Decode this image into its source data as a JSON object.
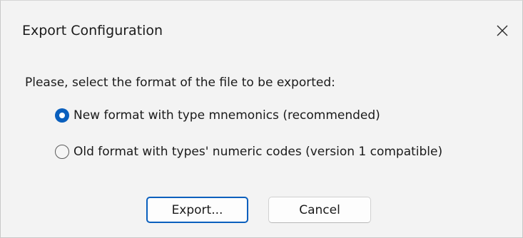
{
  "window": {
    "title": "Export Configuration",
    "close_icon": "close-icon"
  },
  "dialog": {
    "prompt": "Please, select the format of the file to be exported:",
    "options": [
      {
        "label": "New format with type mnemonics (recommended)",
        "selected": true
      },
      {
        "label": "Old format with types' numeric codes (version 1 compatible)",
        "selected": false
      }
    ],
    "buttons": {
      "export_label": "Export...",
      "cancel_label": "Cancel"
    }
  },
  "colors": {
    "accent": "#0a5fbd",
    "dialog_background": "#f3f3f3"
  }
}
